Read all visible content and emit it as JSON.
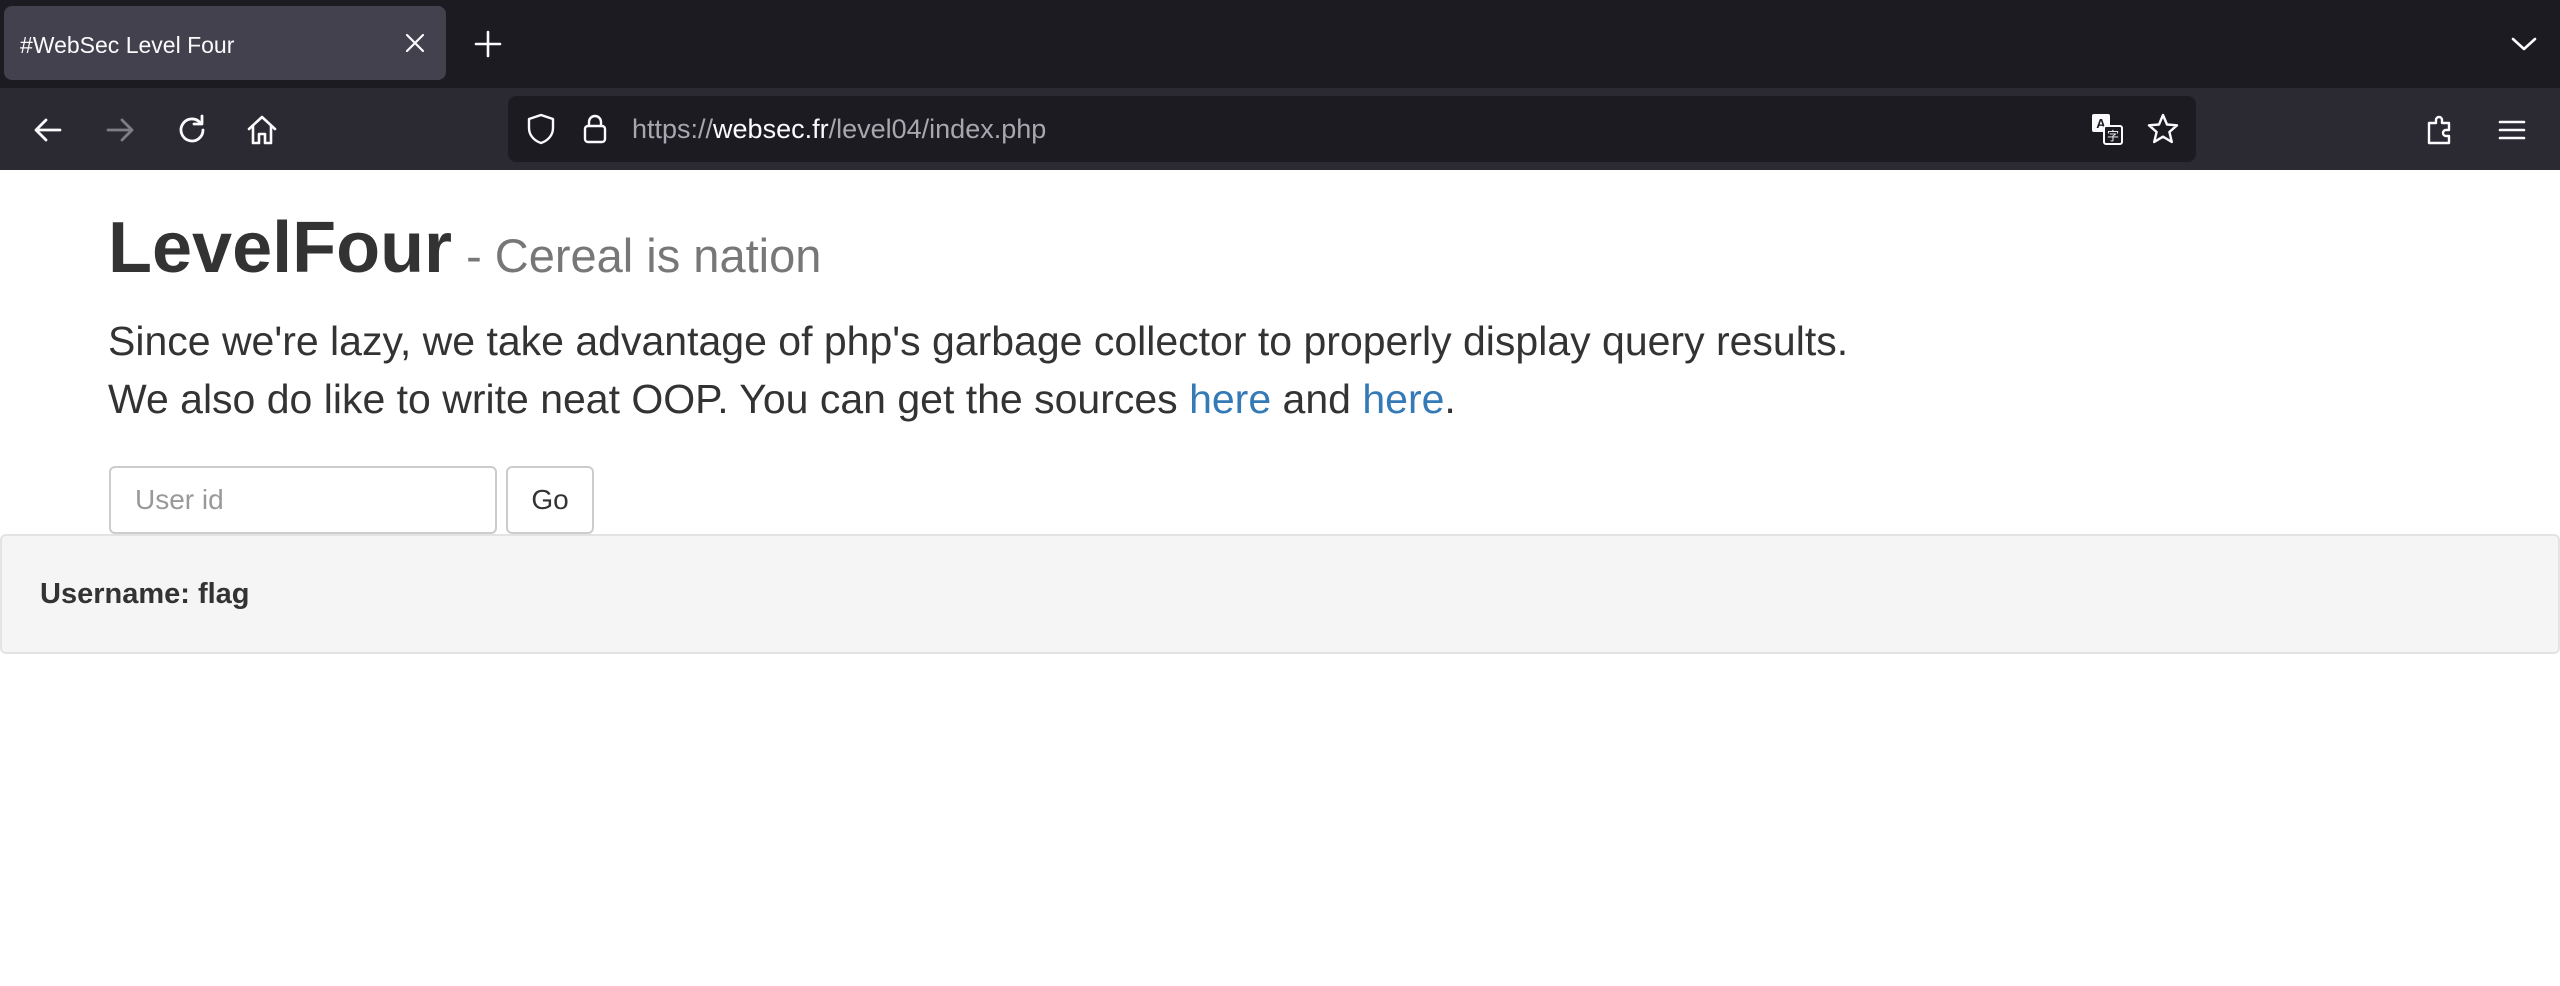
{
  "browser": {
    "tab_title": "#WebSec Level Four",
    "url_scheme": "https://",
    "url_domain": "websec.fr",
    "url_path": "/level04/index.php"
  },
  "page": {
    "title": "LevelFour",
    "subtitle": "- Cereal is nation",
    "lead_line1": "Since we're lazy, we take advantage of php's garbage collector to properly display query results.",
    "lead_line2_prefix": "We also do like to write neat OOP. You can get the sources ",
    "link1": "here",
    "lead_and": " and ",
    "link2": "here",
    "lead_end": ".",
    "input_placeholder": "User id",
    "go_label": "Go",
    "result": "Username: flag"
  },
  "colors": {
    "tab_bar_bg": "#1c1b22",
    "nav_bar_bg": "#2b2a33",
    "link": "#337ab7",
    "well_bg": "#f5f5f5"
  },
  "icons": [
    "close-icon",
    "plus-icon",
    "chevron-down-icon",
    "back-arrow-icon",
    "forward-arrow-icon",
    "reload-icon",
    "home-icon",
    "shield-icon",
    "lock-icon",
    "translate-icon",
    "star-icon",
    "extensions-icon",
    "hamburger-menu-icon"
  ]
}
